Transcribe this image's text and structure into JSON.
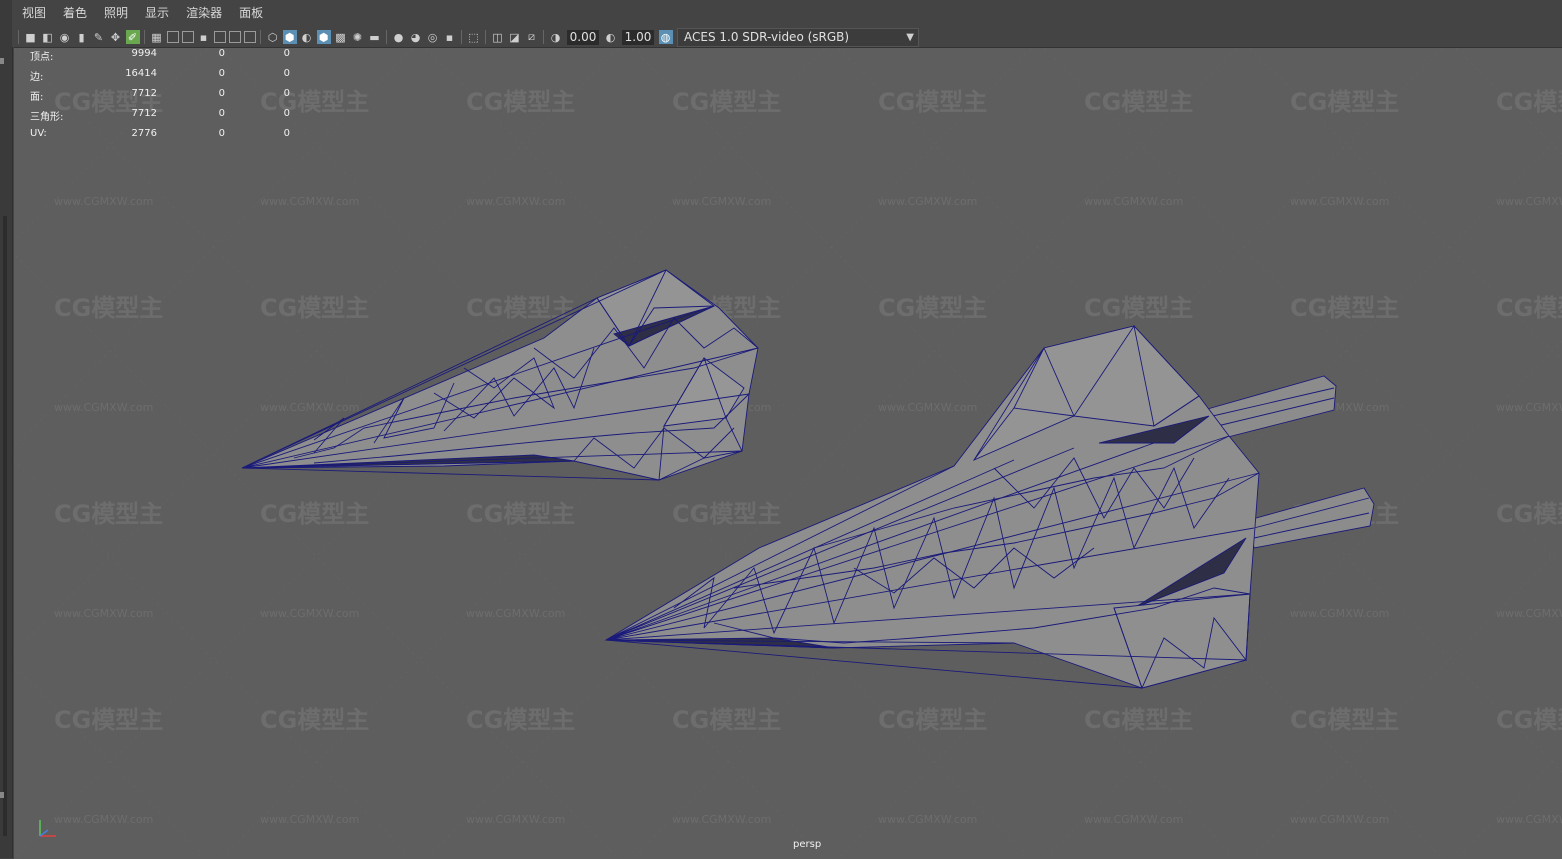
{
  "menu": [
    "视图",
    "着色",
    "照明",
    "显示",
    "渲染器",
    "面板"
  ],
  "toolbar": {
    "exposure": "0.00",
    "gamma": "1.00",
    "color_space": "ACES 1.0 SDR-video (sRGB)"
  },
  "hud": [
    {
      "label": "顶点:",
      "v1": "9994",
      "v2": "0",
      "v3": "0"
    },
    {
      "label": "边:",
      "v1": "16414",
      "v2": "0",
      "v3": "0"
    },
    {
      "label": "面:",
      "v1": "7712",
      "v2": "0",
      "v3": "0"
    },
    {
      "label": "三角形:",
      "v1": "7712",
      "v2": "0",
      "v3": "0"
    },
    {
      "label": "UV:",
      "v1": "2776",
      "v2": "0",
      "v3": "0"
    }
  ],
  "camera_label": "persp",
  "watermark": {
    "logo": "CG模型主",
    "url": "www.CGMXW.com"
  },
  "colors": {
    "wire": "#1a1a7a",
    "mesh": "#8e8e8e",
    "viewport": "#5e5e5e"
  }
}
